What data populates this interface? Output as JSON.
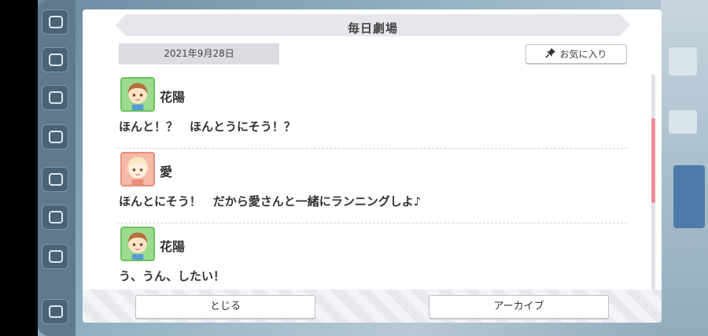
{
  "modal": {
    "title": "毎日劇場",
    "date": "2021年9月28日",
    "favorite_label": "お気に入り",
    "entries": [
      {
        "speaker": "花陽",
        "text": "ほんと！？　ほんとうにそう！？",
        "avatar": "hanayo-avatar"
      },
      {
        "speaker": "愛",
        "text": "ほんとにそう！　だから愛さんと一緒にランニングしよ♪",
        "avatar": "ai-avatar"
      },
      {
        "speaker": "花陽",
        "text": "う、うん、したい！",
        "avatar": "hanayo-avatar"
      }
    ],
    "close_label": "とじる",
    "archive_label": "アーカイブ"
  },
  "colors": {
    "scroll_thumb": "#ef8b96",
    "hanayo_frame": "#6cc25d",
    "ai_frame": "#ea8f7c"
  },
  "icons": {
    "favorite": "pin-icon",
    "menu": "hamburger-menu-icon"
  }
}
